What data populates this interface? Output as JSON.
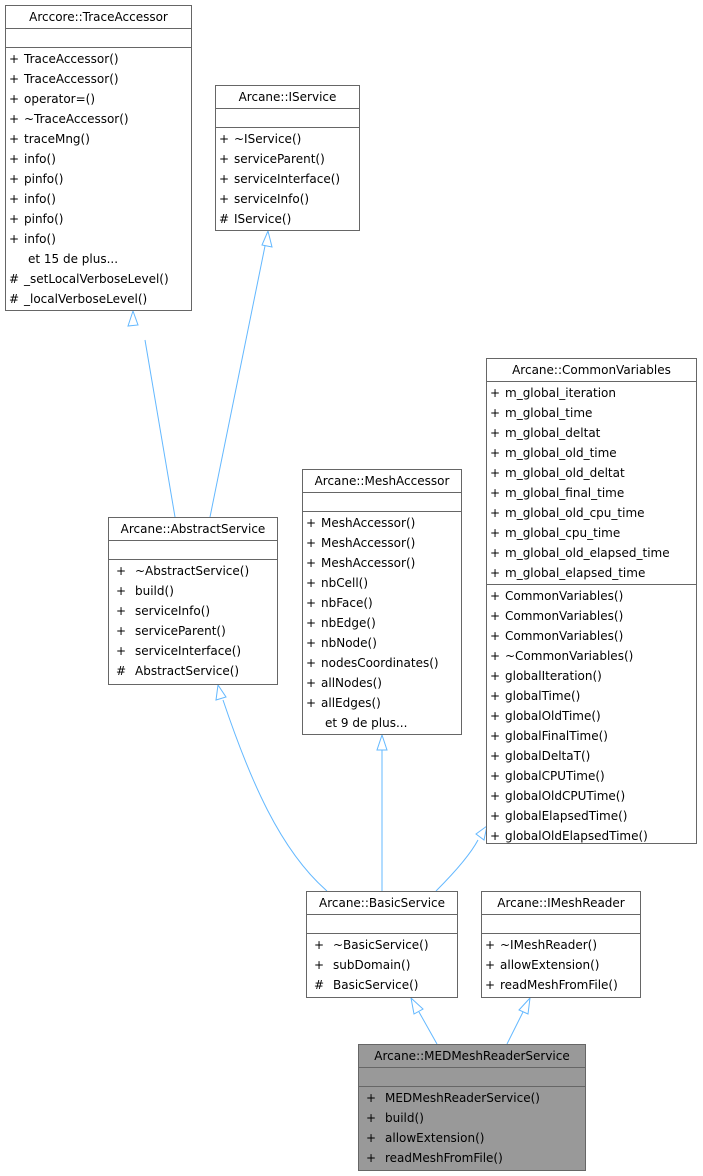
{
  "diagram": {
    "edge_color": "#63b8ff",
    "focus_fill": "#999999",
    "nodes": {
      "trace_accessor": {
        "title": "Arccore::TraceAccessor",
        "attributes": [],
        "operations": [
          {
            "vis": "+",
            "name": "TraceAccessor()"
          },
          {
            "vis": "+",
            "name": "TraceAccessor()"
          },
          {
            "vis": "+",
            "name": "operator=()"
          },
          {
            "vis": "+",
            "name": "~TraceAccessor()"
          },
          {
            "vis": "+",
            "name": "traceMng()"
          },
          {
            "vis": "+",
            "name": "info()"
          },
          {
            "vis": "+",
            "name": "pinfo()"
          },
          {
            "vis": "+",
            "name": "info()"
          },
          {
            "vis": "+",
            "name": "pinfo()"
          },
          {
            "vis": "+",
            "name": "info()"
          },
          {
            "vis": "",
            "name": "et 15 de plus..."
          },
          {
            "vis": "#",
            "name": "_setLocalVerboseLevel()"
          },
          {
            "vis": "#",
            "name": "_localVerboseLevel()"
          }
        ]
      },
      "iservice": {
        "title": "Arcane::IService",
        "attributes": [],
        "operations": [
          {
            "vis": "+",
            "name": "~IService()"
          },
          {
            "vis": "+",
            "name": "serviceParent()"
          },
          {
            "vis": "+",
            "name": "serviceInterface()"
          },
          {
            "vis": "+",
            "name": "serviceInfo()"
          },
          {
            "vis": "#",
            "name": "IService()"
          }
        ]
      },
      "common_variables": {
        "title": "Arcane::CommonVariables",
        "attributes": [
          {
            "vis": "+",
            "name": "m_global_iteration"
          },
          {
            "vis": "+",
            "name": "m_global_time"
          },
          {
            "vis": "+",
            "name": "m_global_deltat"
          },
          {
            "vis": "+",
            "name": "m_global_old_time"
          },
          {
            "vis": "+",
            "name": "m_global_old_deltat"
          },
          {
            "vis": "+",
            "name": "m_global_final_time"
          },
          {
            "vis": "+",
            "name": "m_global_old_cpu_time"
          },
          {
            "vis": "+",
            "name": "m_global_cpu_time"
          },
          {
            "vis": "+",
            "name": "m_global_old_elapsed_time"
          },
          {
            "vis": "+",
            "name": "m_global_elapsed_time"
          }
        ],
        "operations": [
          {
            "vis": "+",
            "name": "CommonVariables()"
          },
          {
            "vis": "+",
            "name": "CommonVariables()"
          },
          {
            "vis": "+",
            "name": "CommonVariables()"
          },
          {
            "vis": "+",
            "name": "~CommonVariables()"
          },
          {
            "vis": "+",
            "name": "globalIteration()"
          },
          {
            "vis": "+",
            "name": "globalTime()"
          },
          {
            "vis": "+",
            "name": "globalOldTime()"
          },
          {
            "vis": "+",
            "name": "globalFinalTime()"
          },
          {
            "vis": "+",
            "name": "globalDeltaT()"
          },
          {
            "vis": "+",
            "name": "globalCPUTime()"
          },
          {
            "vis": "+",
            "name": "globalOldCPUTime()"
          },
          {
            "vis": "+",
            "name": "globalElapsedTime()"
          },
          {
            "vis": "+",
            "name": "globalOldElapsedTime()"
          }
        ]
      },
      "mesh_accessor": {
        "title": "Arcane::MeshAccessor",
        "attributes": [],
        "operations": [
          {
            "vis": "+",
            "name": "MeshAccessor()"
          },
          {
            "vis": "+",
            "name": "MeshAccessor()"
          },
          {
            "vis": "+",
            "name": "MeshAccessor()"
          },
          {
            "vis": "+",
            "name": "nbCell()"
          },
          {
            "vis": "+",
            "name": "nbFace()"
          },
          {
            "vis": "+",
            "name": "nbEdge()"
          },
          {
            "vis": "+",
            "name": "nbNode()"
          },
          {
            "vis": "+",
            "name": "nodesCoordinates()"
          },
          {
            "vis": "+",
            "name": "allNodes()"
          },
          {
            "vis": "+",
            "name": "allEdges()"
          },
          {
            "vis": "",
            "name": "et 9 de plus..."
          }
        ]
      },
      "abstract_service": {
        "title": "Arcane::AbstractService",
        "attributes": [],
        "operations": [
          {
            "vis": "+",
            "name": "~AbstractService()"
          },
          {
            "vis": "+",
            "name": "build()"
          },
          {
            "vis": "+",
            "name": "serviceInfo()"
          },
          {
            "vis": "+",
            "name": "serviceParent()"
          },
          {
            "vis": "+",
            "name": "serviceInterface()"
          },
          {
            "vis": "#",
            "name": "AbstractService()"
          }
        ]
      },
      "basic_service": {
        "title": "Arcane::BasicService",
        "attributes": [],
        "operations": [
          {
            "vis": "+",
            "name": "~BasicService()"
          },
          {
            "vis": "+",
            "name": "subDomain()"
          },
          {
            "vis": "#",
            "name": "BasicService()"
          }
        ]
      },
      "imesh_reader": {
        "title": "Arcane::IMeshReader",
        "attributes": [],
        "operations": [
          {
            "vis": "+",
            "name": "~IMeshReader()"
          },
          {
            "vis": "+",
            "name": "allowExtension()"
          },
          {
            "vis": "+",
            "name": "readMeshFromFile()"
          }
        ]
      },
      "med_mesh_reader_service": {
        "title": "Arcane::MEDMeshReaderService",
        "attributes": [],
        "operations": [
          {
            "vis": "+",
            "name": "MEDMeshReaderService()"
          },
          {
            "vis": "+",
            "name": "build()"
          },
          {
            "vis": "+",
            "name": "allowExtension()"
          },
          {
            "vis": "+",
            "name": "readMeshFromFile()"
          }
        ]
      }
    },
    "edges": [
      {
        "from": "abstract_service",
        "to": "trace_accessor",
        "type": "inheritance"
      },
      {
        "from": "abstract_service",
        "to": "iservice",
        "type": "inheritance"
      },
      {
        "from": "basic_service",
        "to": "abstract_service",
        "type": "inheritance"
      },
      {
        "from": "basic_service",
        "to": "mesh_accessor",
        "type": "inheritance"
      },
      {
        "from": "basic_service",
        "to": "common_variables",
        "type": "inheritance"
      },
      {
        "from": "med_mesh_reader_service",
        "to": "basic_service",
        "type": "inheritance"
      },
      {
        "from": "med_mesh_reader_service",
        "to": "imesh_reader",
        "type": "inheritance"
      }
    ]
  }
}
